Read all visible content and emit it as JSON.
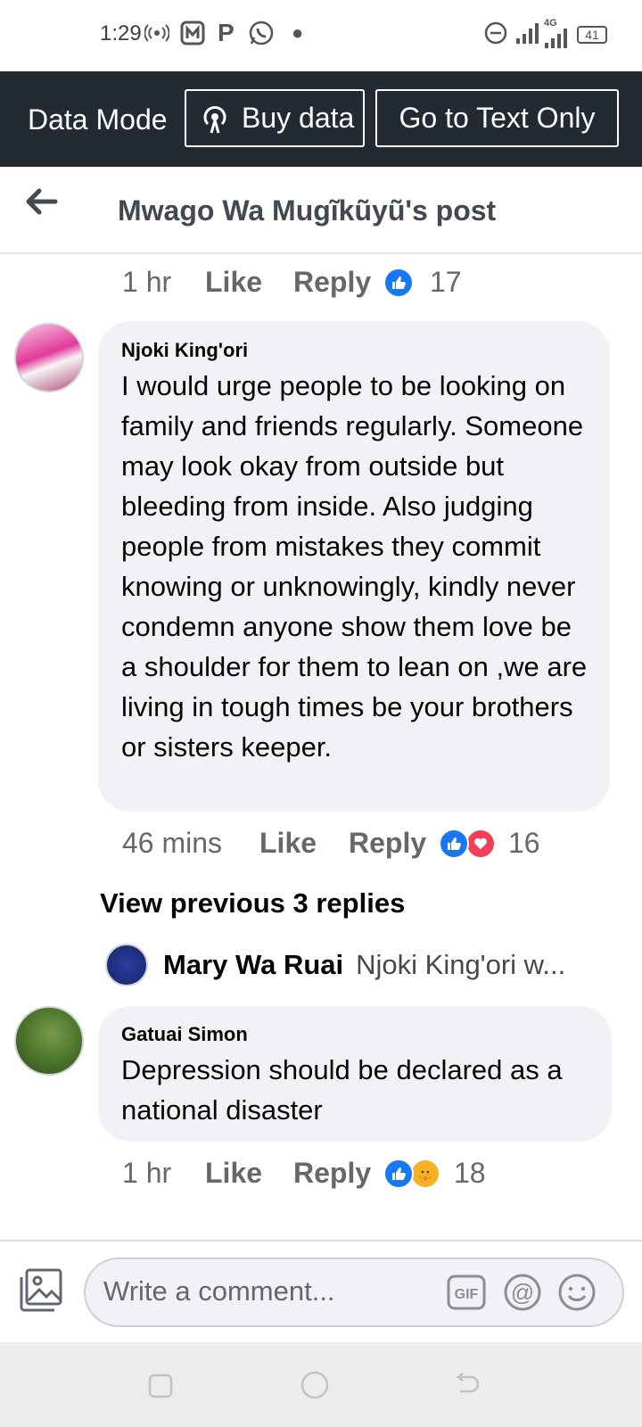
{
  "status_bar": {
    "time": "1:29",
    "network": "4G",
    "battery": "41"
  },
  "data_mode_bar": {
    "label": "Data Mode",
    "buy_data_label": "Buy data",
    "text_only_label": "Go to Text Only"
  },
  "header": {
    "title": "Mwago Wa Mugĩkũyũ's post"
  },
  "actions": {
    "like": "Like",
    "reply": "Reply"
  },
  "prev_comment": {
    "time": "1 hr",
    "reaction_count": "17",
    "reactions": [
      "like-icon"
    ]
  },
  "comments": [
    {
      "author": "Njoki King'ori",
      "text": "I would urge people to be looking on family and friends regularly. Someone may look okay from outside but bleeding from inside. Also judging people from mistakes they commit knowing or unknowingly, kindly never condemn anyone show them love be a shoulder for them to lean on ,we are living in tough times be your brothers or sisters keeper.",
      "time": "46 mins",
      "reaction_count": "16",
      "reactions": [
        "like-icon",
        "love-icon"
      ]
    },
    {
      "author": "Gatuai Simon",
      "text": "Depression should be declared as a national disaster",
      "time": "1 hr",
      "reaction_count": "18",
      "reactions": [
        "like-icon",
        "care-icon"
      ]
    }
  ],
  "replies_link": "View previous 3 replies",
  "reply_preview": {
    "author": "Mary Wa Ruai",
    "text": "Njoki King'ori w..."
  },
  "composer": {
    "placeholder": "Write a comment..."
  },
  "colors": {
    "data_bar_bg": "#242a33",
    "like_blue": "#1877f2",
    "love_red": "#f33e58",
    "bubble_bg": "#f0f2f5"
  }
}
